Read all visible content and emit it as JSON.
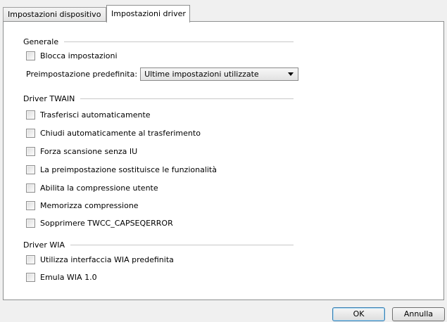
{
  "tabs": [
    {
      "label": "Impostazioni dispositivo"
    },
    {
      "label": "Impostazioni driver"
    }
  ],
  "general": {
    "heading": "Generale",
    "lock_settings": "Blocca impostazioni",
    "preset_label": "Preimpostazione predefinita:",
    "preset_value": "Ultime impostazioni utilizzate"
  },
  "twain": {
    "heading": "Driver TWAIN",
    "options": [
      "Trasferisci automaticamente",
      "Chiudi automaticamente al trasferimento",
      "Forza scansione senza IU",
      "La preimpostazione sostituisce le funzionalità",
      "Abilita la compressione utente",
      "Memorizza compressione",
      "Sopprimere TWCC_CAPSEQERROR"
    ]
  },
  "wia": {
    "heading": "Driver WIA",
    "options": [
      "Utilizza interfaccia WIA predefinita",
      "Emula WIA 1.0"
    ]
  },
  "buttons": {
    "ok": "OK",
    "cancel": "Annulla"
  }
}
